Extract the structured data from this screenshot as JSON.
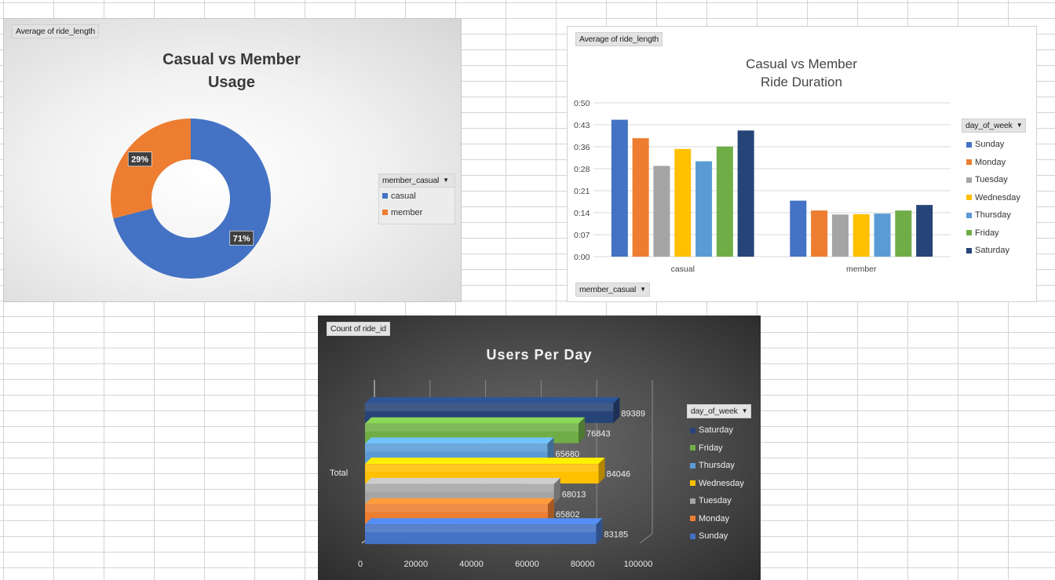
{
  "chart_data": [
    {
      "type": "pie",
      "variant": "donut",
      "title": "Casual vs Member Usage",
      "title_lines": [
        "Casual vs Member",
        "Usage"
      ],
      "value_field": "Average of ride_length",
      "legend_field": "member_casual",
      "legend_placement": "right",
      "categories": [
        "casual",
        "member"
      ],
      "values": [
        71,
        29
      ],
      "labels": [
        "71%",
        "29%"
      ],
      "colors": [
        "#4472c4",
        "#ed7d31"
      ]
    },
    {
      "type": "bar",
      "title": "Casual vs Member Ride Duration",
      "title_lines": [
        "Casual vs Member",
        "Ride Duration"
      ],
      "value_field": "Average of ride_length",
      "axis_field": "member_casual",
      "legend_field": "day_of_week",
      "legend_placement": "right",
      "categories": [
        "casual",
        "member"
      ],
      "yticks": [
        "0:00",
        "0:07",
        "0:14",
        "0:21",
        "0:28",
        "0:36",
        "0:43",
        "0:50"
      ],
      "ylim": [
        0,
        50
      ],
      "grid": true,
      "series": [
        {
          "name": "Sunday",
          "color": "#4472c4",
          "values": [
            44.5,
            18.2
          ]
        },
        {
          "name": "Monday",
          "color": "#ed7d31",
          "values": [
            38.5,
            15.0
          ]
        },
        {
          "name": "Tuesday",
          "color": "#a5a5a5",
          "values": [
            29.5,
            13.7
          ]
        },
        {
          "name": "Wednesday",
          "color": "#ffc000",
          "values": [
            35.0,
            13.8
          ]
        },
        {
          "name": "Thursday",
          "color": "#5b9bd5",
          "values": [
            31.0,
            14.0
          ]
        },
        {
          "name": "Friday",
          "color": "#70ad47",
          "values": [
            35.8,
            15.0
          ]
        },
        {
          "name": "Saturday",
          "color": "#264478",
          "values": [
            41.0,
            16.8
          ]
        }
      ]
    },
    {
      "type": "bar",
      "orientation": "horizontal",
      "title": "Users Per Day",
      "value_field": "Count of ride_id",
      "legend_field": "day_of_week",
      "legend_placement": "right",
      "category": "Total",
      "xticks": [
        "0",
        "20000",
        "40000",
        "60000",
        "80000",
        "100000"
      ],
      "xlim": [
        0,
        100000
      ],
      "series": [
        {
          "name": "Saturday",
          "color": "#264478",
          "value": 89389,
          "label": "89389"
        },
        {
          "name": "Friday",
          "color": "#70ad47",
          "value": 76843,
          "label": "76843"
        },
        {
          "name": "Thursday",
          "color": "#5b9bd5",
          "value": 65680,
          "label": "65680"
        },
        {
          "name": "Wednesday",
          "color": "#ffc000",
          "value": 84046,
          "label": "84046"
        },
        {
          "name": "Tuesday",
          "color": "#a5a5a5",
          "value": 68013,
          "label": "68013"
        },
        {
          "name": "Monday",
          "color": "#ed7d31",
          "value": 65802,
          "label": "65802"
        },
        {
          "name": "Sunday",
          "color": "#4472c4",
          "value": 83185,
          "label": "83185"
        }
      ]
    }
  ]
}
